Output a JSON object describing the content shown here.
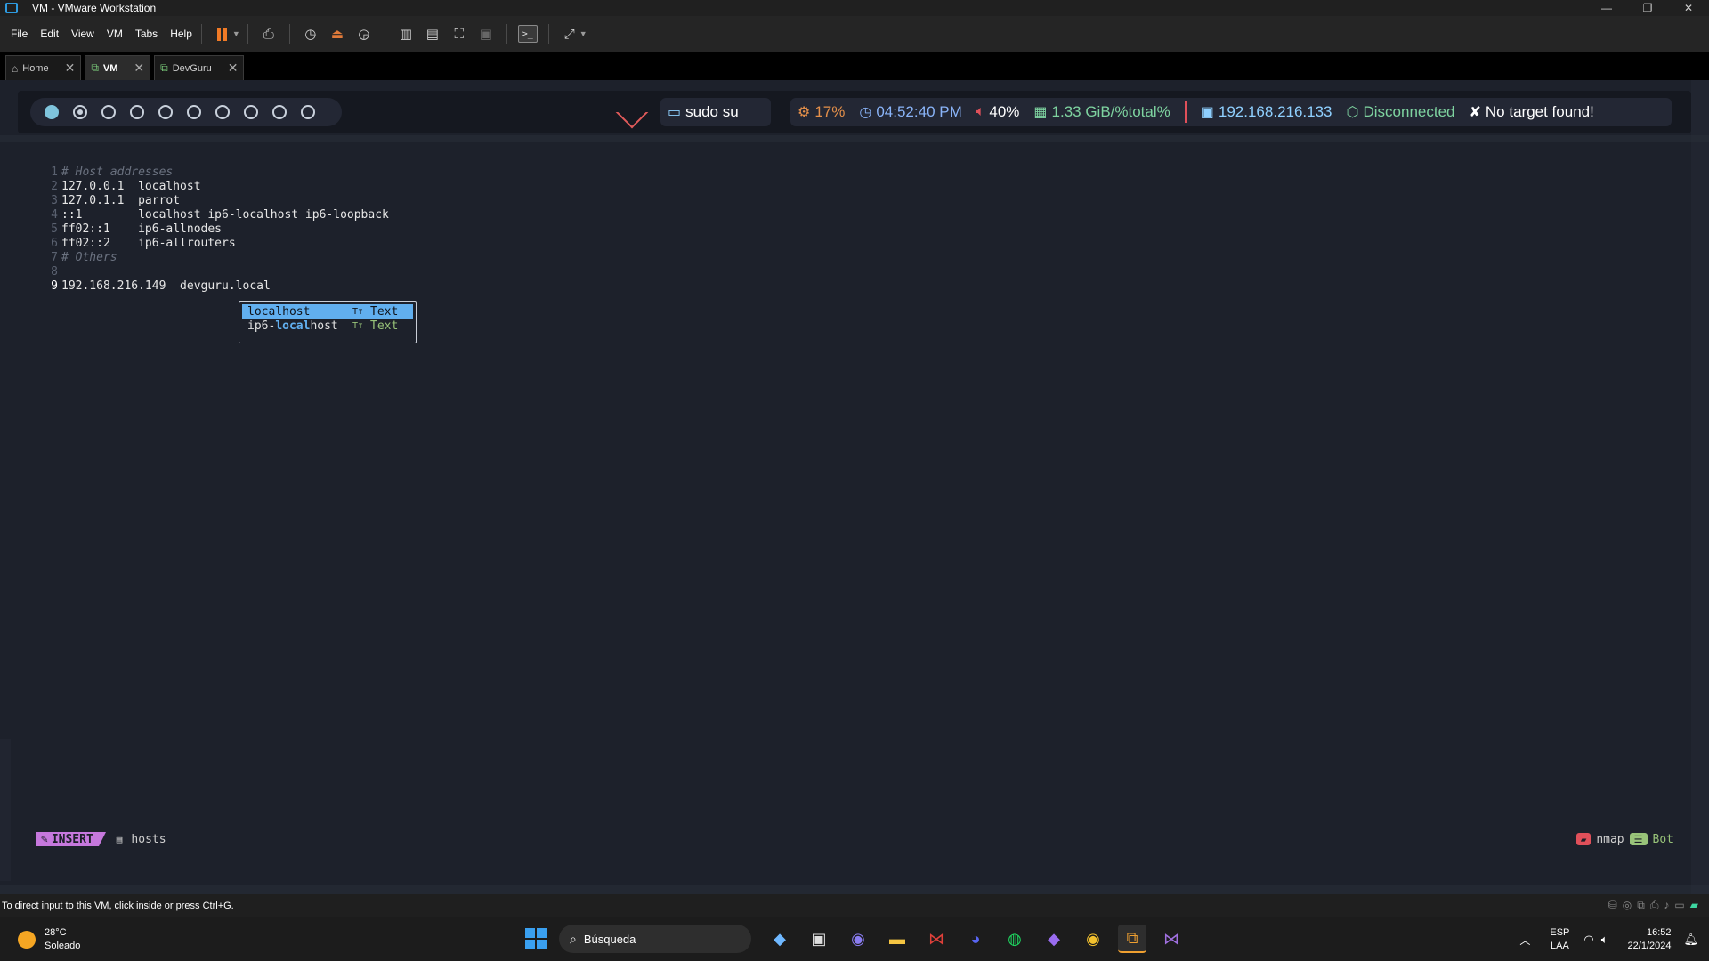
{
  "window": {
    "title": "VM - VMware Workstation",
    "controls": {
      "minimize": "—",
      "restore": "❐",
      "close": "✕"
    }
  },
  "menu": [
    "File",
    "Edit",
    "View",
    "VM",
    "Tabs",
    "Help"
  ],
  "tabs": [
    {
      "label": "Home",
      "icon": "home-icon",
      "active": false
    },
    {
      "label": "VM",
      "icon": "vm-icon",
      "active": true
    },
    {
      "label": "DevGuru",
      "icon": "vm-icon",
      "active": false
    }
  ],
  "polybar": {
    "workspaces": 10,
    "active_workspace": 1,
    "current_workspace": 2,
    "command": "sudo su",
    "cpu": "17%",
    "time": "04:52:40 PM",
    "volume": "40%",
    "memory": "1.33 GiB/%total%",
    "ip": "192.168.216.133",
    "vpn": "Disconnected",
    "target": "No target found!",
    "colors": {
      "cpu": "#e5904a",
      "time": "#8ab4f8",
      "volume": "#ffffff",
      "memory": "#7ed3a0",
      "ip": "#8fd0ff",
      "vpn": "#7ed3a0",
      "target": "#ffffff"
    }
  },
  "editor": {
    "lines": [
      {
        "n": "1",
        "text": "# Host addresses",
        "comment": true
      },
      {
        "n": "2",
        "text": "127.0.0.1  localhost",
        "comment": false
      },
      {
        "n": "3",
        "text": "127.0.1.1  parrot",
        "comment": false
      },
      {
        "n": "4",
        "text": "::1        localhost ip6-localhost ip6-loopback",
        "comment": false
      },
      {
        "n": "5",
        "text": "ff02::1    ip6-allnodes",
        "comment": false
      },
      {
        "n": "6",
        "text": "ff02::2    ip6-allrouters",
        "comment": false
      },
      {
        "n": "7",
        "text": "# Others",
        "comment": true
      },
      {
        "n": "8",
        "text": "",
        "comment": false
      },
      {
        "n": "9",
        "text": "192.168.216.149  devguru.local",
        "comment": false,
        "current": true
      }
    ],
    "completion": [
      {
        "match": "local",
        "rest": "host",
        "prefix": "",
        "kind": "Text",
        "selected": true
      },
      {
        "match": "local",
        "rest": "host",
        "prefix": "ip6-",
        "kind": "Text",
        "selected": false
      }
    ]
  },
  "statusline": {
    "mode": "INSERT",
    "file": "hosts",
    "filetype": "nmap",
    "position": "Bot"
  },
  "vm_status": {
    "hint": "To direct input to this VM, click inside or press Ctrl+G."
  },
  "taskbar": {
    "weather_temp": "28°C",
    "weather_desc": "Soleado",
    "search_placeholder": "Búsqueda",
    "lang_top": "ESP",
    "lang_bottom": "LAA",
    "time": "16:52",
    "date": "22/1/2024"
  }
}
